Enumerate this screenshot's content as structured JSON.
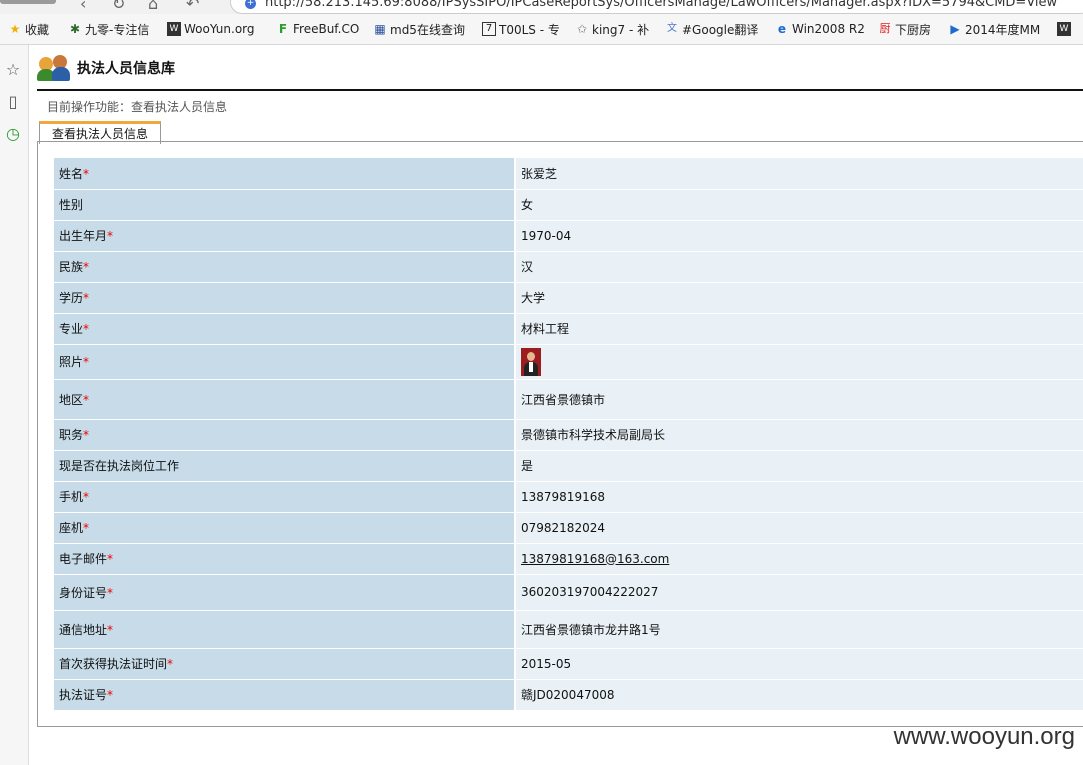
{
  "browser": {
    "url": "http://58.213.145.69:8088/IPSysSIPO/IPCaseReportSys/OfficersManage/LawOfficers/Manager.aspx?IDX=5794&CMD=View",
    "bookmarks": [
      "收藏",
      "九零-专注信",
      "WooYun.org",
      "FreeBuf.CO",
      "md5在线查询",
      "T00LS - 专",
      "king7 - 补",
      "#Google翻译",
      "Win2008 R2",
      "下厨房",
      "2014年度MM"
    ]
  },
  "header": {
    "title": "执法人员信息库"
  },
  "breadcrumb": "目前操作功能：查看执法人员信息",
  "tab": "查看执法人员信息",
  "rows": [
    {
      "label": "姓名",
      "req": "*",
      "value": "张爱芝"
    },
    {
      "label": "性别",
      "req": "",
      "value": "女"
    },
    {
      "label": "出生年月",
      "req": "*",
      "value": "1970-04"
    },
    {
      "label": "民族",
      "req": "*",
      "value": "汉"
    },
    {
      "label": "学历",
      "req": "*",
      "value": "大学"
    },
    {
      "label": "专业",
      "req": "*",
      "value": "材料工程"
    },
    {
      "label": "照片",
      "req": "*",
      "value": ""
    },
    {
      "label": "地区",
      "req": "*",
      "value": "江西省景德镇市"
    },
    {
      "label": "职务",
      "req": "*",
      "value": "景德镇市科学技术局副局长"
    },
    {
      "label": "现是否在执法岗位工作",
      "req": "",
      "value": "是"
    },
    {
      "label": "手机",
      "req": "*",
      "value": "13879819168"
    },
    {
      "label": "座机",
      "req": "*",
      "value": "07982182024"
    },
    {
      "label": "电子邮件",
      "req": "*",
      "value": "13879819168@163.com"
    },
    {
      "label": "身份证号",
      "req": "*",
      "value": "360203197004222027"
    },
    {
      "label": "通信地址",
      "req": "*",
      "value": "江西省景德镇市龙井路1号"
    },
    {
      "label": "首次获得执法证时间",
      "req": "*",
      "value": "2015-05"
    },
    {
      "label": "执法证号",
      "req": "*",
      "value": "赣JD020047008"
    }
  ],
  "watermark": "www.wooyun.org",
  "colors": {
    "label_bg": "#c7dce8",
    "value_bg": "#e9f1f6",
    "required": "#ee0000",
    "tab_accent": "#f0a83a"
  }
}
